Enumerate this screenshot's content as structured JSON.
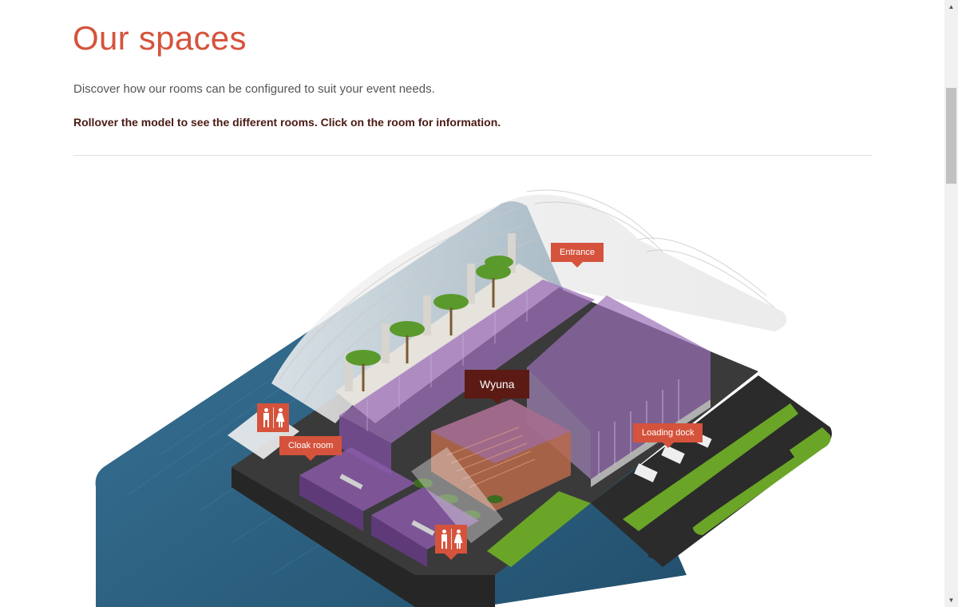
{
  "page": {
    "title": "Our spaces",
    "intro": "Discover how our rooms can be configured to suit your event needs.",
    "instruction": "Rollover the model to see the different rooms. Click on the room for information."
  },
  "model": {
    "labels": {
      "entrance": "Entrance",
      "wyuna": "Wyuna",
      "cloak_room": "Cloak room",
      "loading_dock": "Loading dock"
    },
    "icons": [
      "toilets-icon",
      "toilets-icon"
    ]
  },
  "colors": {
    "accent": "#d5533c",
    "accent_dark": "#5c1a14",
    "water": "#2d6586",
    "room_purple": "#9b6fb8",
    "grass": "#6aa527",
    "road": "#2b2b2b"
  }
}
